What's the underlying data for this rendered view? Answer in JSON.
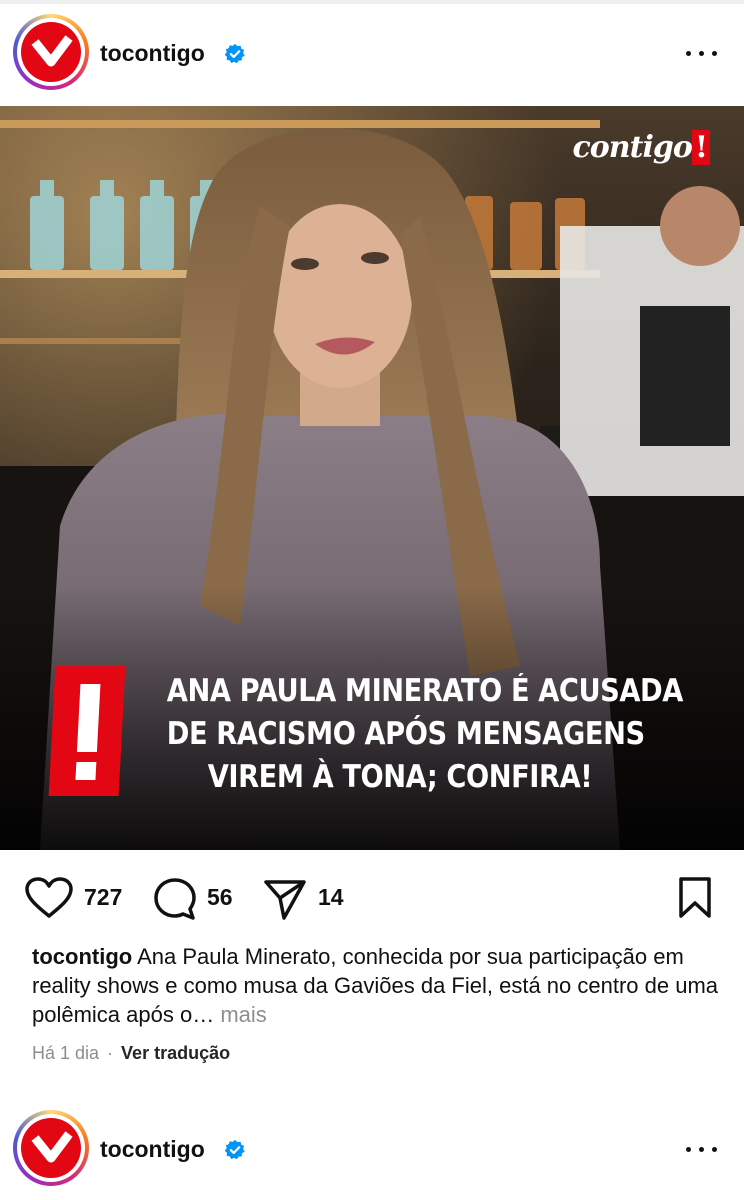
{
  "post1": {
    "username": "tocontigo",
    "image": {
      "brand": "contigo",
      "brand_mark": "!",
      "headline_lines": [
        "ANA PAULA MINERATO É ACUSADA",
        "DE RACISMO APÓS MENSAGENS",
        "VIREM À TONA; CONFIRA!"
      ]
    },
    "likes": "727",
    "comments": "56",
    "shares": "14",
    "caption_user": "tocontigo",
    "caption_text": "Ana Paula Minerato, conhecida por sua participação em reality shows e como musa da Gaviões da Fiel, está no centro de uma polêmica após o…",
    "caption_more": "mais",
    "time": "Há 1 dia",
    "separator": "·",
    "translate": "Ver tradução"
  },
  "post2": {
    "username": "tocontigo"
  },
  "colors": {
    "brand_red": "#e30613",
    "verified_blue": "#0095f6",
    "muted": "#8e8e8e"
  },
  "icons": [
    "verified-badge-icon",
    "more-options-icon",
    "heart-icon",
    "comment-icon",
    "share-icon",
    "bookmark-icon"
  ]
}
